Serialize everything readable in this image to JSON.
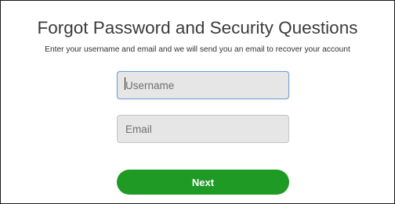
{
  "form": {
    "title": "Forgot Password and Security Questions",
    "subtitle": "Enter your username and email and we will send you an email to recover your account",
    "username": {
      "value": "",
      "placeholder": "Username"
    },
    "email": {
      "value": "",
      "placeholder": "Email"
    },
    "next_label": "Next"
  },
  "colors": {
    "button_green": "#1f9a24",
    "focus_border": "#6fa0d6",
    "field_background": "#e6e6e6"
  }
}
